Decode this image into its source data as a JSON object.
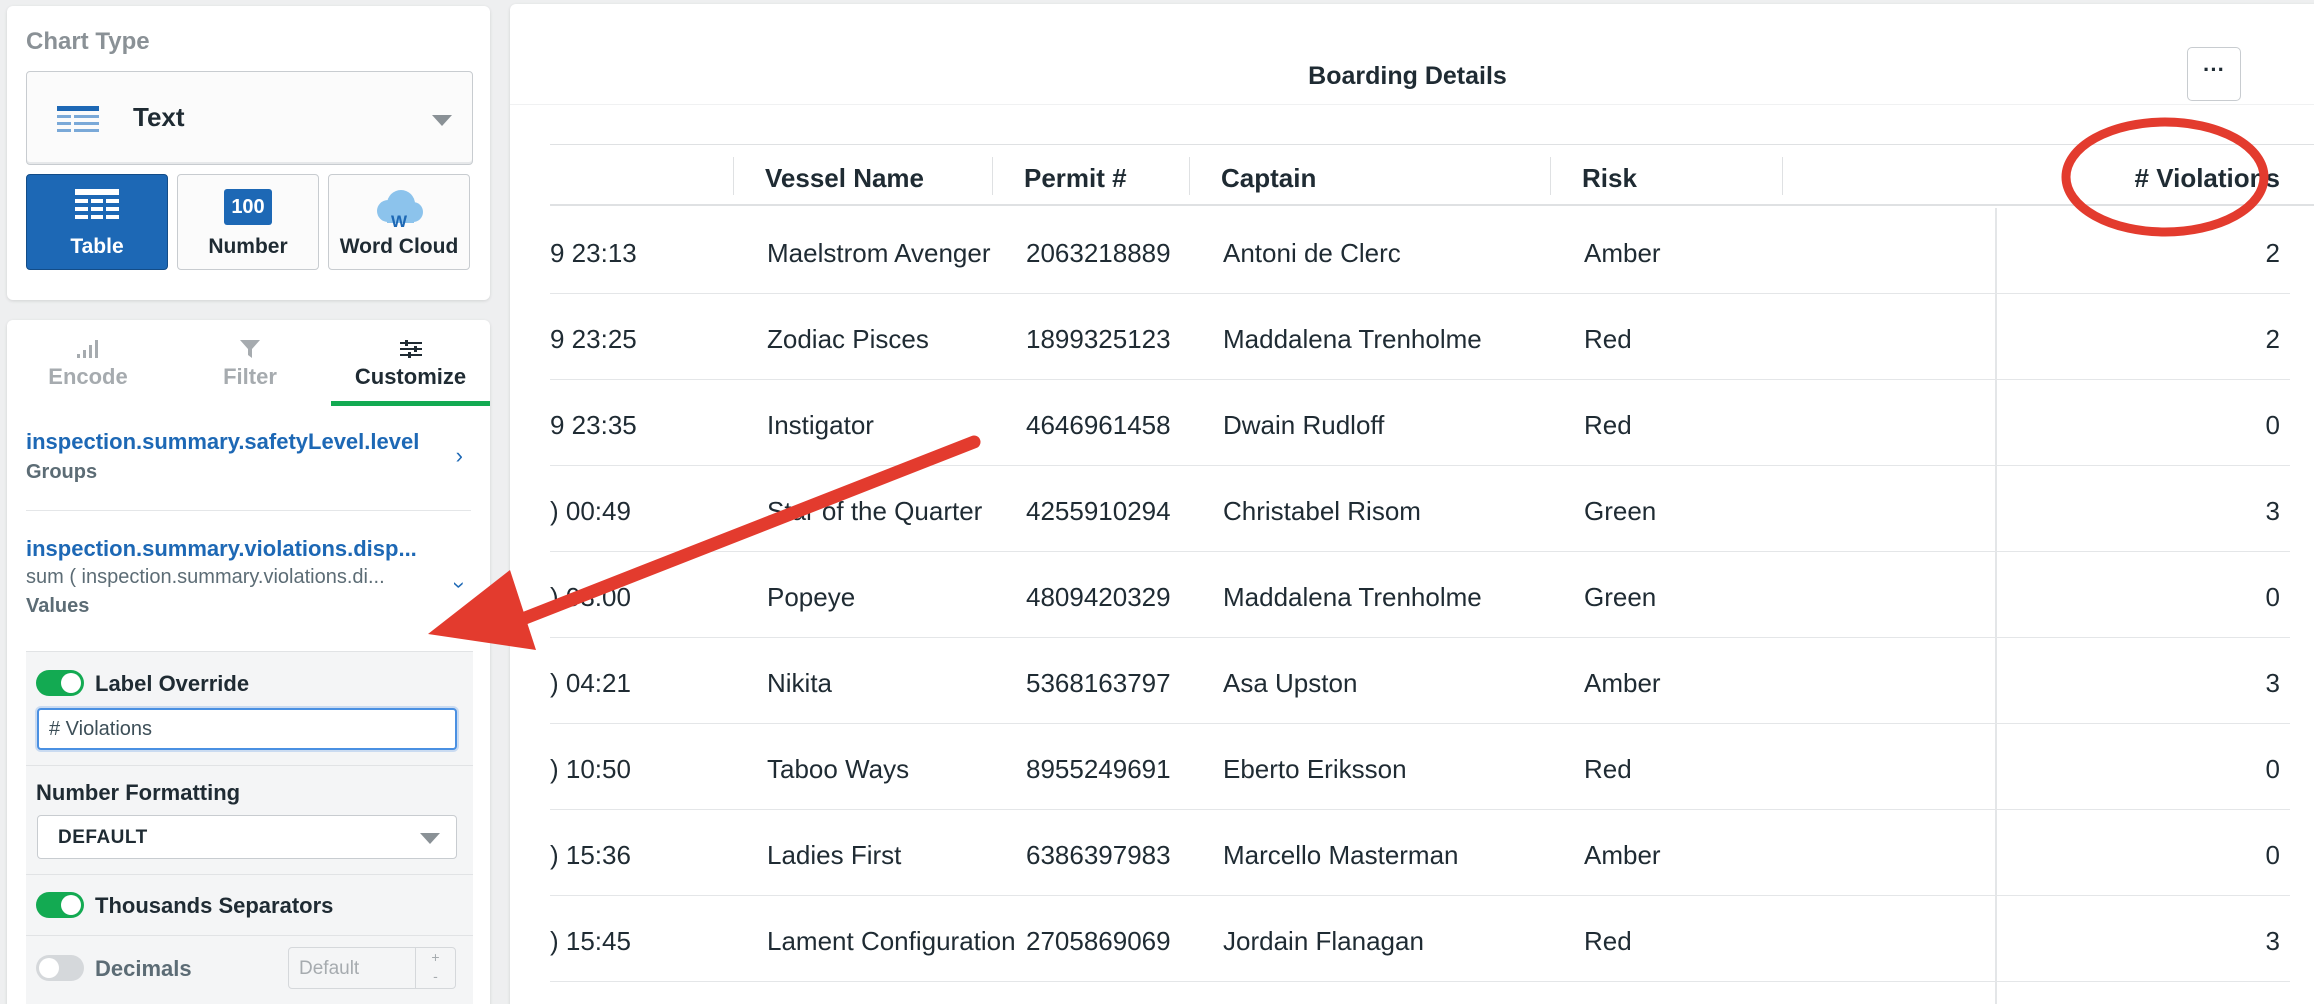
{
  "left_panel": {
    "chart_type_title": "Chart Type",
    "selected_type": "Text",
    "type_buttons": [
      {
        "label": "Table",
        "active": true
      },
      {
        "label": "Number",
        "badge": "100",
        "active": false
      },
      {
        "label": "Word Cloud",
        "badge": "W",
        "active": false
      }
    ],
    "tabs": [
      {
        "label": "Encode",
        "icon": "bar-signal-icon",
        "active": false
      },
      {
        "label": "Filter",
        "icon": "funnel-icon",
        "active": false
      },
      {
        "label": "Customize",
        "icon": "sliders-icon",
        "active": true
      }
    ],
    "fields": [
      {
        "name": "inspection.summary.safetyLevel.level",
        "role": "Groups"
      },
      {
        "name": "inspection.summary.violations.disp...",
        "aggregation": "sum ( inspection.summary.violations.di...",
        "role": "Values"
      }
    ],
    "options": {
      "label_override": {
        "label": "Label Override",
        "enabled": true,
        "value": "# Violations"
      },
      "number_formatting": {
        "label": "Number Formatting",
        "value": "DEFAULT"
      },
      "thousands_separators": {
        "label": "Thousands Separators",
        "enabled": true
      },
      "decimals": {
        "label": "Decimals",
        "enabled": false,
        "placeholder": "Default",
        "stepper_up": "+",
        "stepper_down": "-"
      }
    }
  },
  "main": {
    "title": "Boarding Details",
    "menu_label": "···",
    "columns": [
      "Vessel Name",
      "Permit #",
      "Captain",
      "Risk",
      "# Violations"
    ],
    "rows": [
      {
        "time": "9 23:13",
        "vessel": "Maelstrom Avenger",
        "permit": "2063218889",
        "captain": "Antoni de Clerc",
        "risk": "Amber",
        "violations": "2"
      },
      {
        "time": "9 23:25",
        "vessel": "Zodiac Pisces",
        "permit": "1899325123",
        "captain": "Maddalena Trenholme",
        "risk": "Red",
        "violations": "2"
      },
      {
        "time": "9 23:35",
        "vessel": "Instigator",
        "permit": "4646961458",
        "captain": "Dwain Rudloff",
        "risk": "Red",
        "violations": "0"
      },
      {
        "time": ") 00:49",
        "vessel": "Star of the Quarter",
        "permit": "4255910294",
        "captain": "Christabel Risom",
        "risk": "Green",
        "violations": "3"
      },
      {
        "time": ") 03:00",
        "vessel": "Popeye",
        "permit": "4809420329",
        "captain": "Maddalena Trenholme",
        "risk": "Green",
        "violations": "0"
      },
      {
        "time": ") 04:21",
        "vessel": "Nikita",
        "permit": "5368163797",
        "captain": "Asa Upston",
        "risk": "Amber",
        "violations": "3"
      },
      {
        "time": ") 10:50",
        "vessel": "Taboo Ways",
        "permit": "8955249691",
        "captain": "Eberto Eriksson",
        "risk": "Red",
        "violations": "0"
      },
      {
        "time": ") 15:36",
        "vessel": "Ladies First",
        "permit": "6386397983",
        "captain": "Marcello Masterman",
        "risk": "Amber",
        "violations": "0"
      },
      {
        "time": ") 15:45",
        "vessel": "Lament Configuration",
        "permit": "2705869069",
        "captain": "Jordain Flanagan",
        "risk": "Red",
        "violations": "3"
      }
    ]
  },
  "colors": {
    "accent_blue": "#1d68b5",
    "toggle_green": "#13aa52",
    "annotation_red": "#e33b2e"
  }
}
